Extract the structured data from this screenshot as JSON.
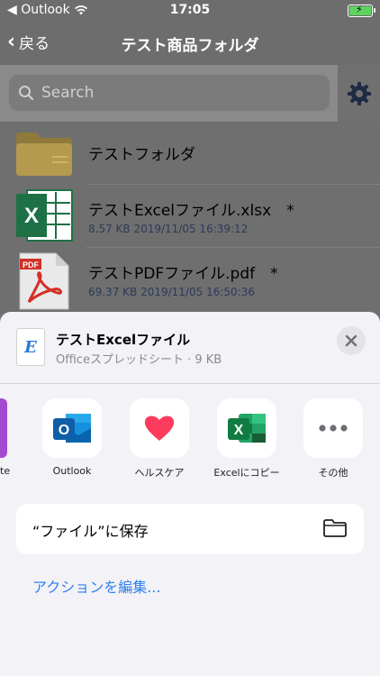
{
  "status_bar": {
    "carrier": "◀ Outlook",
    "time": "17:05"
  },
  "nav": {
    "back_label": "戻る",
    "title": "テスト商品フォルダ"
  },
  "search": {
    "placeholder": "Search"
  },
  "files": [
    {
      "name": "テストフォルダ",
      "type": "folder"
    },
    {
      "name": "テストExcelファイル.xlsx　*",
      "meta": "8.57 KB   2019/11/05 16:39:12",
      "type": "excel"
    },
    {
      "name": "テストPDFファイル.pdf　*",
      "meta": "69.37 KB   2019/11/05 16:50:36",
      "type": "pdf"
    }
  ],
  "share_sheet": {
    "doc_icon_letter": "E",
    "title": "テストExcelファイル",
    "subtitle": "Officeスプレッドシート · 9 KB",
    "partial_app_label": "te",
    "apps": [
      {
        "label": "Outlook",
        "icon": "outlook-icon"
      },
      {
        "label": "ヘルスケア",
        "icon": "health-heart-icon"
      },
      {
        "label": "Excelにコピー",
        "icon": "excel-icon"
      },
      {
        "label": "その他",
        "icon": "more-icon"
      }
    ],
    "save_action": "“ファイル”に保存",
    "edit_actions": "アクションを編集..."
  },
  "colors": {
    "accent": "#2f80ed",
    "excel_green": "#1e7145",
    "pdf_red": "#d22f27",
    "folder": "#b49a4d"
  }
}
